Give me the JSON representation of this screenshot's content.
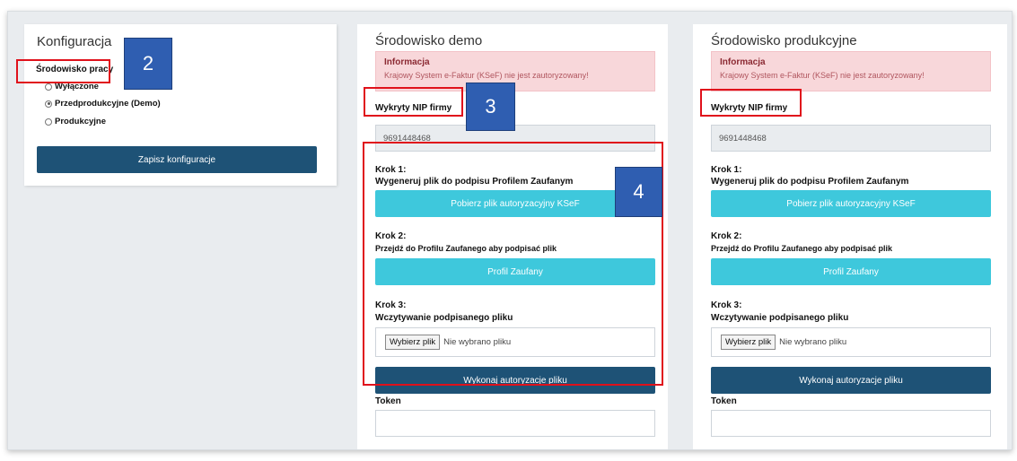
{
  "config": {
    "title": "Konfiguracja",
    "env_label": "Środowisko pracy",
    "options": [
      "Wyłączone",
      "Przedprodukcyjne (Demo)",
      "Produkcyjne"
    ],
    "selected_option": "Przedprodukcyjne (Demo)",
    "save_label": "Zapisz konfiguracje"
  },
  "demo": {
    "title": "Środowisko demo",
    "alert_title": "Informacja",
    "alert_msg": "Krajowy System e-Faktur (KSeF) nie jest zautoryzowany!",
    "nip_label": "Wykryty NIP firmy",
    "nip_value": "9691448468",
    "step1_title": "Krok 1:",
    "step1_desc": "Wygeneruj plik do podpisu Profilem Zaufanym",
    "step1_button": "Pobierz plik autoryzacyjny KSeF",
    "step2_title": "Krok 2:",
    "step2_desc": "Przejdź do Profilu Zaufanego aby podpisać plik",
    "step2_button": "Profil Zaufany",
    "step3_title": "Krok 3:",
    "step3_desc": "Wczytywanie podpisanego pliku",
    "file_button": "Wybierz plik",
    "file_status": "Nie wybrano pliku",
    "auth_button": "Wykonaj autoryzacje pliku",
    "token_label": "Token"
  },
  "prod": {
    "title": "Środowisko produkcyjne",
    "alert_title": "Informacja",
    "alert_msg": "Krajowy System e-Faktur (KSeF) nie jest zautoryzowany!",
    "nip_label": "Wykryty NIP firmy",
    "nip_value": "9691448468",
    "step1_title": "Krok 1:",
    "step1_desc": "Wygeneruj plik do podpisu Profilem Zaufanym",
    "step1_button": "Pobierz plik autoryzacyjny KSeF",
    "step2_title": "Krok 2:",
    "step2_desc": "Przejdź do Profilu Zaufanego aby podpisać plik",
    "step2_button": "Profil Zaufany",
    "step3_title": "Krok 3:",
    "step3_desc": "Wczytywanie podpisanego pliku",
    "file_button": "Wybierz plik",
    "file_status": "Nie wybrano pliku",
    "auth_button": "Wykonaj autoryzacje pliku",
    "token_label": "Token"
  },
  "annotations": {
    "badge_2": "2",
    "badge_3": "3",
    "badge_4": "4",
    "highlight_color": "#e0111b",
    "badge_color": "#2f5eb1"
  }
}
